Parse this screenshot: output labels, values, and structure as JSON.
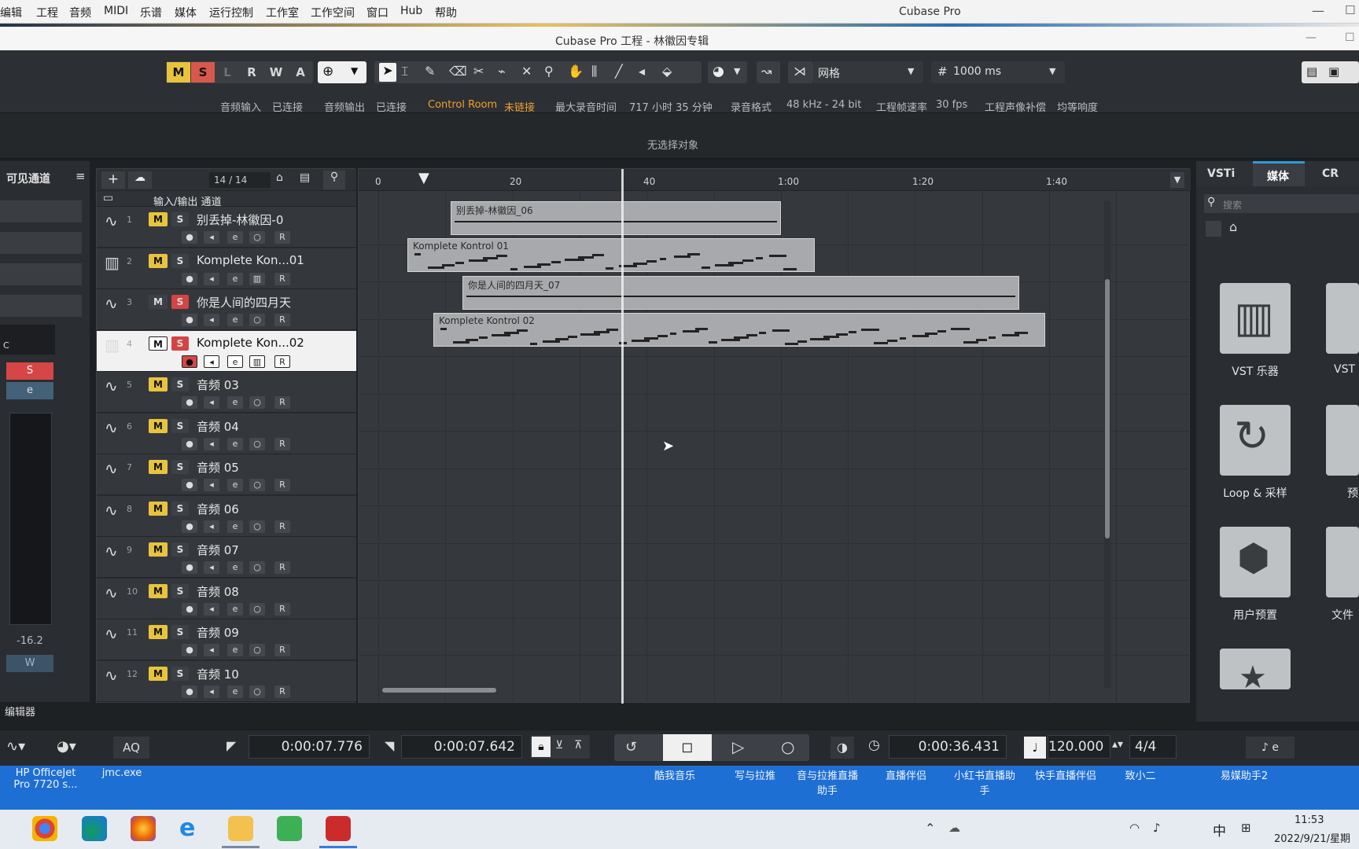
{
  "menubar": {
    "items": [
      "编辑",
      "工程",
      "音频",
      "MIDI",
      "乐谱",
      "媒体",
      "运行控制",
      "工作室",
      "工作空间",
      "窗口",
      "Hub",
      "帮助"
    ],
    "app_title": "Cubase Pro"
  },
  "window": {
    "title": "Cubase Pro 工程 - 林徽因专辑"
  },
  "toolbar": {
    "mode_buttons": [
      "M",
      "S",
      "L",
      "R",
      "W",
      "A"
    ],
    "snap_type": "网格",
    "quantize": "1000 ms",
    "status": {
      "audio_in_label": "音频输入",
      "audio_in_value": "已连接",
      "audio_out_label": "音频输出",
      "audio_out_value": "已连接",
      "control_room_label": "Control Room",
      "control_room_value": "未链接",
      "max_rec_label": "最大录音时间",
      "max_rec_value": "717 小时 35 分钟",
      "rec_format_label": "录音格式",
      "rec_format_value": "48 kHz - 24 bit",
      "frame_rate_label": "工程帧速率",
      "frame_rate_value": "30 fps",
      "pan_label": "工程声像补偿",
      "pan_value": "均等响度"
    }
  },
  "info_line": "无选择对象",
  "left_panel": {
    "title": "可见通道",
    "s_button": "S",
    "e_button": "e",
    "meter_value": "-16.2",
    "w_button": "W",
    "c_label": "C",
    "footer": "编辑器"
  },
  "tracklist": {
    "count": "14 / 14",
    "folder_name": "输入/输出 通道",
    "tracks": [
      {
        "num": "1",
        "name": "别丢掉-林徽因-0",
        "type": "audio"
      },
      {
        "num": "2",
        "name": "Komplete Kon...01",
        "type": "instrument"
      },
      {
        "num": "3",
        "name": "你是人间的四月天",
        "type": "audio"
      },
      {
        "num": "4",
        "name": "Komplete Kon...02",
        "type": "instrument"
      },
      {
        "num": "5",
        "name": "音频 03",
        "type": "audio"
      },
      {
        "num": "6",
        "name": "音频 04",
        "type": "audio"
      },
      {
        "num": "7",
        "name": "音频 05",
        "type": "audio"
      },
      {
        "num": "8",
        "name": "音频 06",
        "type": "audio"
      },
      {
        "num": "9",
        "name": "音频 07",
        "type": "audio"
      },
      {
        "num": "10",
        "name": "音频 08",
        "type": "audio"
      },
      {
        "num": "11",
        "name": "音频 09",
        "type": "audio"
      },
      {
        "num": "12",
        "name": "音频 10",
        "type": "audio"
      }
    ],
    "m_label": "M",
    "s_label": "S",
    "r_label": "R"
  },
  "ruler": {
    "labels": [
      "0",
      "20",
      "40",
      "1:00",
      "1:20",
      "1:40"
    ]
  },
  "clips": [
    {
      "name": "别丢掉-林徽因_06"
    },
    {
      "name": "Komplete Kontrol 01"
    },
    {
      "name": "你是人间的四月天_07"
    },
    {
      "name": "Komplete Kontrol 02"
    }
  ],
  "right_panel": {
    "tabs": [
      "VSTi",
      "媒体",
      "CR"
    ],
    "search_placeholder": "搜索",
    "tiles": [
      "VST 乐器",
      "Loop & 采样",
      "用户预置"
    ],
    "partial_labels": [
      "VST",
      "预",
      "文件"
    ]
  },
  "transport": {
    "aq": "AQ",
    "left_locator": "0:00:07.776",
    "right_locator": "0:00:07.642",
    "position": "0:00:36.431",
    "tempo": "120.000",
    "signature": "4/4"
  },
  "taskbar": {
    "desktop_items": [
      "HP OfficeJet\nPro 7720 s...",
      "jmc.exe",
      "酷我音乐",
      "写与拉推",
      "音与拉推直播\n助手",
      "直播伴侣",
      "小红书直播助\n手",
      "快手直播伴侣",
      "致小二",
      "易媒助手2"
    ],
    "tray_lang": "中",
    "clock_time": "11:53",
    "clock_date": "2022/9/21/星期"
  }
}
